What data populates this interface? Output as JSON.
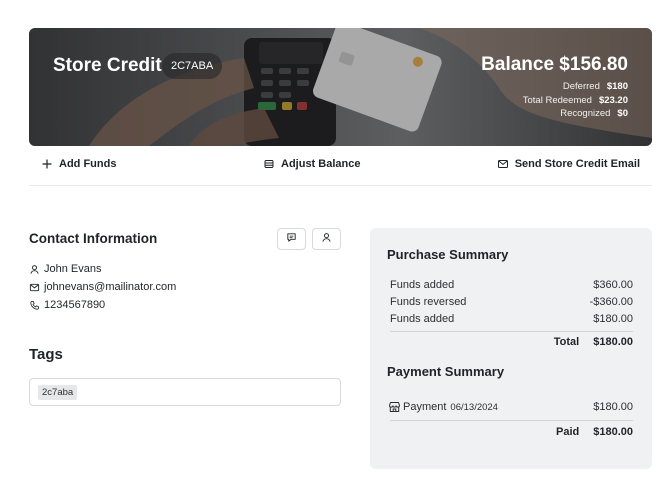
{
  "hero": {
    "title": "Store Credit",
    "code": "2C7ABA",
    "balance": "Balance $156.80",
    "stats": [
      {
        "label": "Deferred",
        "value": "$180"
      },
      {
        "label": "Total Redeemed",
        "value": "$23.20"
      },
      {
        "label": "Recognized",
        "value": "$0"
      }
    ]
  },
  "actions": {
    "add_funds": "Add Funds",
    "adjust_balance": "Adjust Balance",
    "send_email": "Send Store Credit Email"
  },
  "contact": {
    "title": "Contact Information",
    "name": "John Evans",
    "email": "johnevans@mailinator.com",
    "phone": "1234567890"
  },
  "tags": {
    "title": "Tags",
    "items": [
      "2c7aba"
    ]
  },
  "purchase_summary": {
    "title": "Purchase Summary",
    "lines": [
      {
        "label": "Funds added",
        "amount": "$360.00"
      },
      {
        "label": "Funds reversed",
        "amount": "-$360.00"
      },
      {
        "label": "Funds added",
        "amount": "$180.00"
      }
    ],
    "total_label": "Total",
    "total_amount": "$180.00"
  },
  "payment_summary": {
    "title": "Payment Summary",
    "payment_label": "Payment",
    "payment_date": "06/13/2024",
    "payment_amount": "$180.00",
    "paid_label": "Paid",
    "paid_amount": "$180.00"
  }
}
